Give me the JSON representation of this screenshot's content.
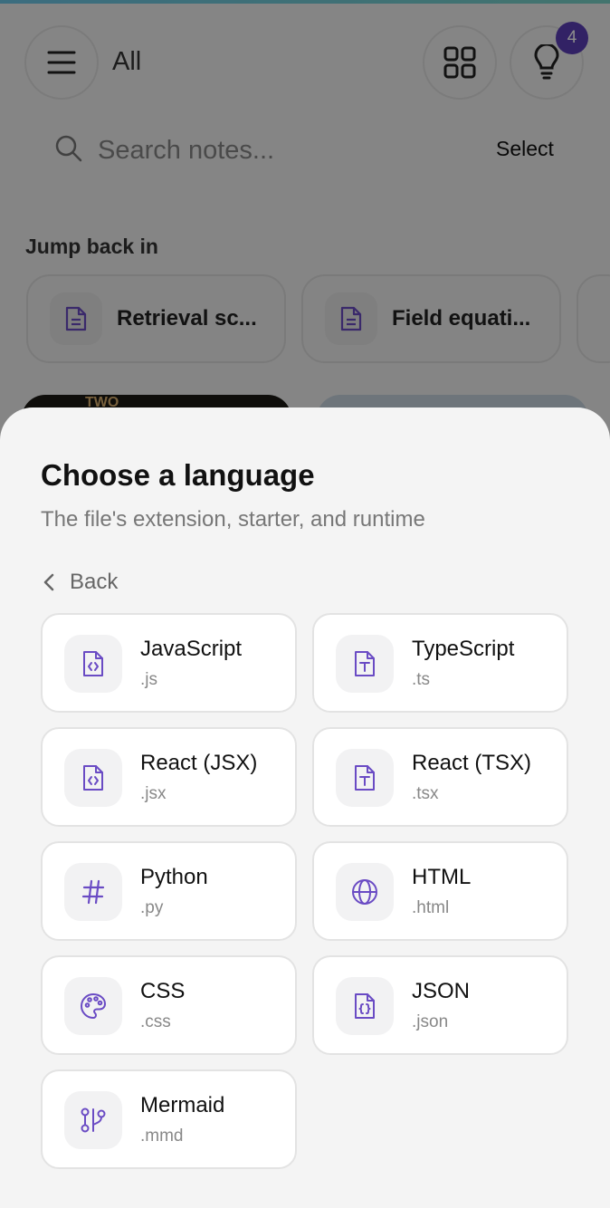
{
  "header": {
    "filter_label": "All",
    "badge_count": "4"
  },
  "search": {
    "placeholder": "Search notes...",
    "select_label": "Select"
  },
  "jump_back": {
    "title": "Jump back in",
    "items": [
      {
        "label": "Retrieval sc..."
      },
      {
        "label": "Field equati..."
      }
    ],
    "thumb_text": "TWO"
  },
  "sheet": {
    "title": "Choose a language",
    "subtitle": "The file's extension, starter, and runtime",
    "back_label": "Back",
    "languages": [
      {
        "name": "JavaScript",
        "ext": ".js",
        "icon": "file-code-icon"
      },
      {
        "name": "TypeScript",
        "ext": ".ts",
        "icon": "file-type-icon"
      },
      {
        "name": "React (JSX)",
        "ext": ".jsx",
        "icon": "file-code-icon"
      },
      {
        "name": "React (TSX)",
        "ext": ".tsx",
        "icon": "file-type-icon"
      },
      {
        "name": "Python",
        "ext": ".py",
        "icon": "hash-icon"
      },
      {
        "name": "HTML",
        "ext": ".html",
        "icon": "globe-icon"
      },
      {
        "name": "CSS",
        "ext": ".css",
        "icon": "palette-icon"
      },
      {
        "name": "JSON",
        "ext": ".json",
        "icon": "file-json-icon"
      },
      {
        "name": "Mermaid",
        "ext": ".mmd",
        "icon": "git-branch-icon"
      }
    ]
  },
  "colors": {
    "accent": "#6a4bc4",
    "badge": "#5b3fb8"
  }
}
